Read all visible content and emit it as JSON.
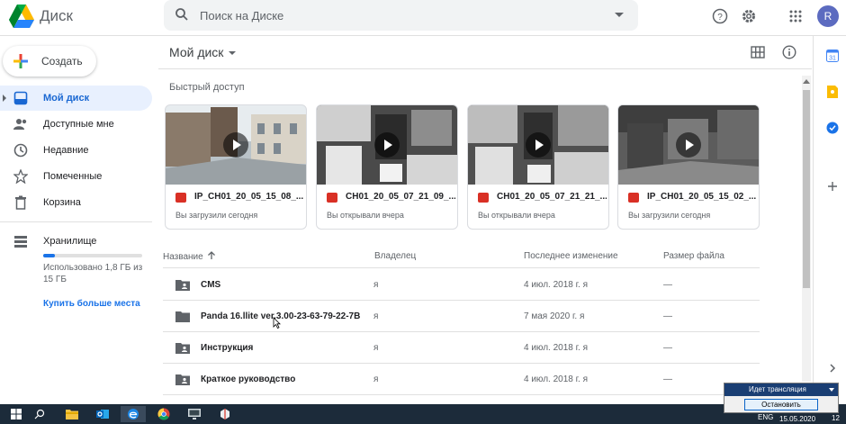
{
  "header": {
    "brand": "Диск",
    "search_placeholder": "Поиск на Диске",
    "avatar_letter": "R"
  },
  "sidebar": {
    "create_label": "Создать",
    "items": [
      {
        "label": "Мой диск",
        "icon": "drive-icon",
        "active": true
      },
      {
        "label": "Доступные мне",
        "icon": "people-icon"
      },
      {
        "label": "Недавние",
        "icon": "clock-icon"
      },
      {
        "label": "Помеченные",
        "icon": "star-icon"
      },
      {
        "label": "Корзина",
        "icon": "trash-icon"
      }
    ],
    "storage_label": "Хранилище",
    "storage_used_text": "Использовано 1,8 ГБ из 15 ГБ",
    "storage_fraction": 0.12,
    "buy_more": "Купить больше места"
  },
  "main": {
    "title": "Мой диск",
    "quick_access_title": "Быстрый доступ",
    "quick_access": [
      {
        "name": "IP_CH01_20_05_15_08_...",
        "subtitle": "Вы загрузили сегодня",
        "thumb": "street"
      },
      {
        "name": "CH01_20_05_07_21_09_...",
        "subtitle": "Вы открывали вчера",
        "thumb": "room-bw"
      },
      {
        "name": "CH01_20_05_07_21_21_...",
        "subtitle": "Вы открывали вчера",
        "thumb": "room-bw"
      },
      {
        "name": "IP_CH01_20_05_15_02_...",
        "subtitle": "Вы загрузили сегодня",
        "thumb": "night"
      }
    ],
    "columns": {
      "name": "Название",
      "owner": "Владелец",
      "modified": "Последнее изменение",
      "size": "Размер файла"
    },
    "files": [
      {
        "name": "CMS",
        "owner": "я",
        "modified": "4 июл. 2018 г.",
        "modified_by": "я",
        "size": "—",
        "icon": "shared-folder-icon"
      },
      {
        "name": "Panda 16.llite ver.3.00-23-63-79-22-7B",
        "owner": "я",
        "modified": "7 мая 2020 г.",
        "modified_by": "я",
        "size": "—",
        "icon": "folder-icon"
      },
      {
        "name": "Инструкция",
        "owner": "я",
        "modified": "4 июл. 2018 г.",
        "modified_by": "я",
        "size": "—",
        "icon": "shared-folder-icon"
      },
      {
        "name": "Краткое руководство",
        "owner": "я",
        "modified": "4 июл. 2018 г.",
        "modified_by": "я",
        "size": "—",
        "icon": "shared-folder-icon"
      }
    ]
  },
  "broadcast": {
    "status": "Идет трансляция",
    "stop_button": "Остановить"
  },
  "taskbar": {
    "lang": "ENG",
    "date": "15.05.2020",
    "notif_count": "12"
  },
  "colors": {
    "accent": "#1a73e8",
    "active_bg": "#e8f0fe",
    "taskbar": "#1c2b3a"
  }
}
